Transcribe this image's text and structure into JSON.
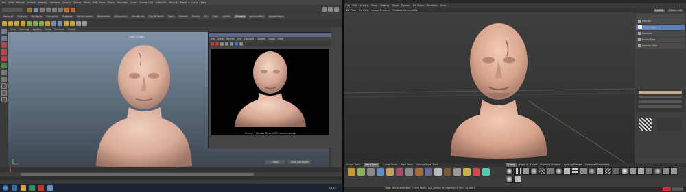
{
  "left_monitor": {
    "app": "Maya",
    "menus": [
      "File",
      "Edit",
      "Modify",
      "Create",
      "Display",
      "Window",
      "Assets",
      "Select",
      "Mesh",
      "Edit Mesh",
      "Proxy",
      "Normals",
      "Color",
      "Create UVs",
      "Edit UVs",
      "Muscle",
      "Pipeline Cache",
      "Help"
    ],
    "shelf_tabs": [
      {
        "label": "General",
        "active": false
      },
      {
        "label": "Curves",
        "active": false
      },
      {
        "label": "Surfaces",
        "active": false
      },
      {
        "label": "Polygons",
        "active": false
      },
      {
        "label": "Subdivs",
        "active": false
      },
      {
        "label": "Deformation",
        "active": false
      },
      {
        "label": "Animation",
        "active": false
      },
      {
        "label": "Dynamics",
        "active": false
      },
      {
        "label": "Rendering",
        "active": false
      },
      {
        "label": "PaintEffects",
        "active": false
      },
      {
        "label": "Toon",
        "active": false
      },
      {
        "label": "Muscle",
        "active": false
      },
      {
        "label": "Fluids",
        "active": false
      },
      {
        "label": "Fur",
        "active": false
      },
      {
        "label": "Hair",
        "active": false
      },
      {
        "label": "nCloth",
        "active": false
      },
      {
        "label": "Custom",
        "active": true
      },
      {
        "label": "generalSkin",
        "active": false
      },
      {
        "label": "polyActions",
        "active": false
      }
    ],
    "viewport_menus": [
      "View",
      "Shading",
      "Lighting",
      "Show",
      "Renderer",
      "Panels"
    ],
    "viewport_label": "High Quality",
    "render_window": {
      "menus": [
        "File",
        "View",
        "Render",
        "IPR",
        "Options",
        "Display",
        "Show",
        "Help"
      ],
      "info_lines": [
        "Frame: 1     Render Time: 0:03     Camera: persp"
      ]
    },
    "buttons": {
      "close": "Close",
      "save": "Save Attributes"
    },
    "taskbar_time": "18:22"
  },
  "right_monitor": {
    "app": "Mudbox",
    "menus": [
      "File",
      "Edit",
      "Create",
      "Mesh",
      "Display",
      "Maps",
      "Render",
      "UV Maps",
      "Windows",
      "Help"
    ],
    "view_tabs": [
      "3D View",
      "UV View",
      "Image Browser",
      "Mudbox Community"
    ],
    "panel_tabs": [
      "Layers",
      "Object List"
    ],
    "layers": [
      {
        "label": "Diffuse",
        "selected": false
      },
      {
        "label": "Paint Layer 1",
        "selected": true
      },
      {
        "label": "Specular",
        "selected": false
      },
      {
        "label": "Bump Map",
        "selected": false
      },
      {
        "label": "Normal Map",
        "selected": false
      }
    ],
    "tool_tabs": [
      "Sculpt Tools",
      "Paint Tools",
      "Curve Tools",
      "Pose Tools",
      "Select/Move Tools"
    ],
    "tools": [
      "Paint Brush",
      "Projection",
      "Eyedropper",
      "Airbrush",
      "Pencil",
      "Paint Erase",
      "Clone",
      "Dry Brush",
      "Blur",
      "Dodge",
      "Burn",
      "Contrast",
      "Sponge",
      "Hue",
      "Hue Shift"
    ],
    "tray_tabs": [
      "Stamp",
      "Stencil",
      "Falloff",
      "Material Presets",
      "Lighting Presets",
      "Camera Bookmarks"
    ],
    "status": "Total: 8006  Selected: 0  GPU Mem: 743  Active: 8, Highest: 8  FPS: 34.6887"
  }
}
